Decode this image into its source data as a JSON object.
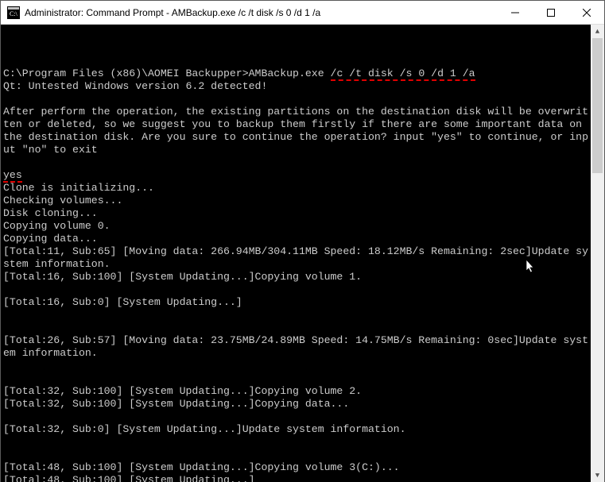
{
  "window": {
    "title": "Administrator: Command Prompt - AMBackup.exe  /c /t disk /s 0 /d 1 /a"
  },
  "prompt": {
    "path": "C:\\Program Files (x86)\\AOMEI Backupper>",
    "cmd_prefix": "AMBackup.exe ",
    "cmd_highlight": "/c /t disk /s 0 /d 1 /a"
  },
  "lines": {
    "qt": "Qt: Untested Windows version 6.2 detected!",
    "warn": "After perform the operation, the existing partitions on the destination disk will be overwritten or deleted, so we suggest you to backup them firstly if there are some important data on the destination disk. Are you sure to continue the operation? input \"yes\" to continue, or input \"no\" to exit",
    "yes": "yes",
    "l1": "Clone is initializing...",
    "l2": "Checking volumes...",
    "l3": "Disk cloning...",
    "l4": "Copying volume 0.",
    "l5": "Copying data...",
    "p1": "[Total:11, Sub:65] [Moving data: 266.94MB/304.11MB Speed: 18.12MB/s Remaining: 2sec]Update system information.",
    "p2": "[Total:16, Sub:100] [System Updating...]Copying volume 1.",
    "p3": "[Total:16, Sub:0] [System Updating...]",
    "p4": "[Total:26, Sub:57] [Moving data: 23.75MB/24.89MB Speed: 14.75MB/s Remaining: 0sec]Update system information.",
    "p5": "[Total:32, Sub:100] [System Updating...]Copying volume 2.",
    "p6": "[Total:32, Sub:100] [System Updating...]Copying data...",
    "p7": "[Total:32, Sub:0] [System Updating...]Update system information.",
    "p8": "[Total:48, Sub:100] [System Updating...]Copying volume 3(C:)...",
    "p9": "[Total:48, Sub:100] [System Updating...]"
  }
}
